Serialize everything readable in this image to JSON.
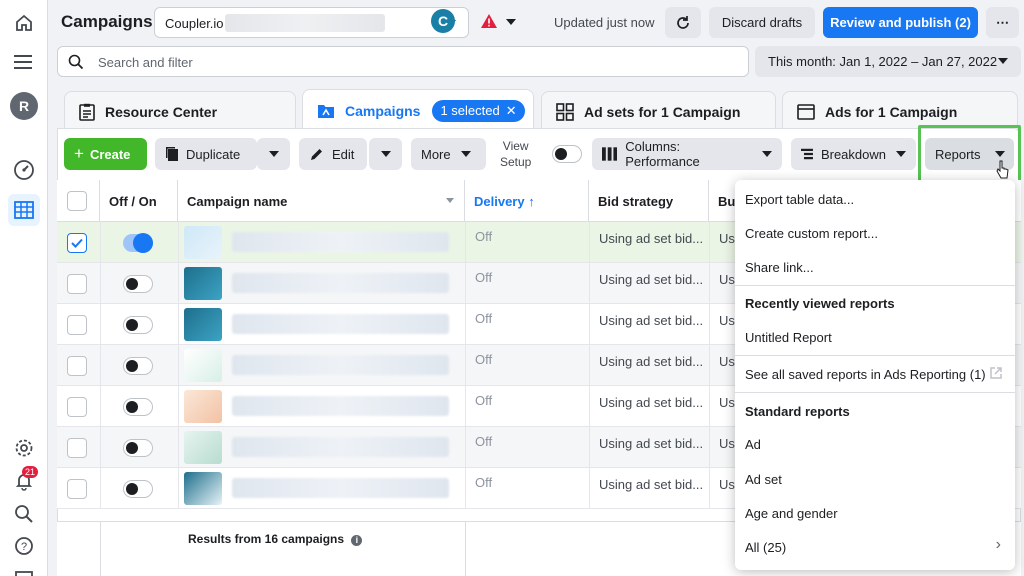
{
  "topbar": {
    "title": "Campaigns",
    "account_name": "Coupler.io",
    "updated": "Updated just now",
    "discard_label": "Discard drafts",
    "publish_label": "Review and publish (2)",
    "more_label": "⋯"
  },
  "search": {
    "placeholder": "Search and filter"
  },
  "date_range": "This month: Jan 1, 2022 – Jan 27, 2022",
  "tabs": [
    {
      "label": "Resource Center"
    },
    {
      "label": "Campaigns",
      "badge": "1 selected"
    },
    {
      "label": "Ad sets for 1 Campaign"
    },
    {
      "label": "Ads for 1 Campaign"
    }
  ],
  "toolbar": {
    "create": "Create",
    "duplicate": "Duplicate",
    "edit": "Edit",
    "more": "More",
    "view_setup_1": "View",
    "view_setup_2": "Setup",
    "columns": "Columns: Performance",
    "breakdown": "Breakdown",
    "reports": "Reports"
  },
  "table": {
    "headers": [
      "Off / On",
      "Campaign name",
      "Delivery ↑",
      "Bid strategy",
      "Bu"
    ],
    "rows": [
      {
        "delivery": "Off",
        "bid": "Using ad set bid...",
        "budget": "Us",
        "on": true,
        "checked": true
      },
      {
        "delivery": "Off",
        "bid": "Using ad set bid...",
        "budget": "Us",
        "on": false,
        "checked": false
      },
      {
        "delivery": "Off",
        "bid": "Using ad set bid...",
        "budget": "Us",
        "on": false,
        "checked": false
      },
      {
        "delivery": "Off",
        "bid": "Using ad set bid...",
        "budget": "Us",
        "on": false,
        "checked": false
      },
      {
        "delivery": "Off",
        "bid": "Using ad set bid...",
        "budget": "Us",
        "on": false,
        "checked": false
      },
      {
        "delivery": "Off",
        "bid": "Using ad set bid...",
        "budget": "Us",
        "on": false,
        "checked": false
      },
      {
        "delivery": "Off",
        "bid": "Using ad set bid...",
        "budget": "Us",
        "on": false,
        "checked": false
      }
    ],
    "results": "Results from 16 campaigns"
  },
  "reports_menu": {
    "export": "Export table data...",
    "custom": "Create custom report...",
    "share": "Share link...",
    "recent_header": "Recently viewed reports",
    "untitled": "Untitled Report",
    "see_all": "See all saved reports in Ads Reporting (1)",
    "standard_header": "Standard reports",
    "ad": "Ad",
    "ad_set": "Ad set",
    "age_gender": "Age and gender",
    "all": "All (25)"
  },
  "rail": {
    "avatar_initial": "R",
    "notifications": "21"
  },
  "colors": {
    "accent": "#1877f2",
    "create": "#42b72a",
    "highlight": "#58c255",
    "selected_row": "#ebf5e6"
  }
}
